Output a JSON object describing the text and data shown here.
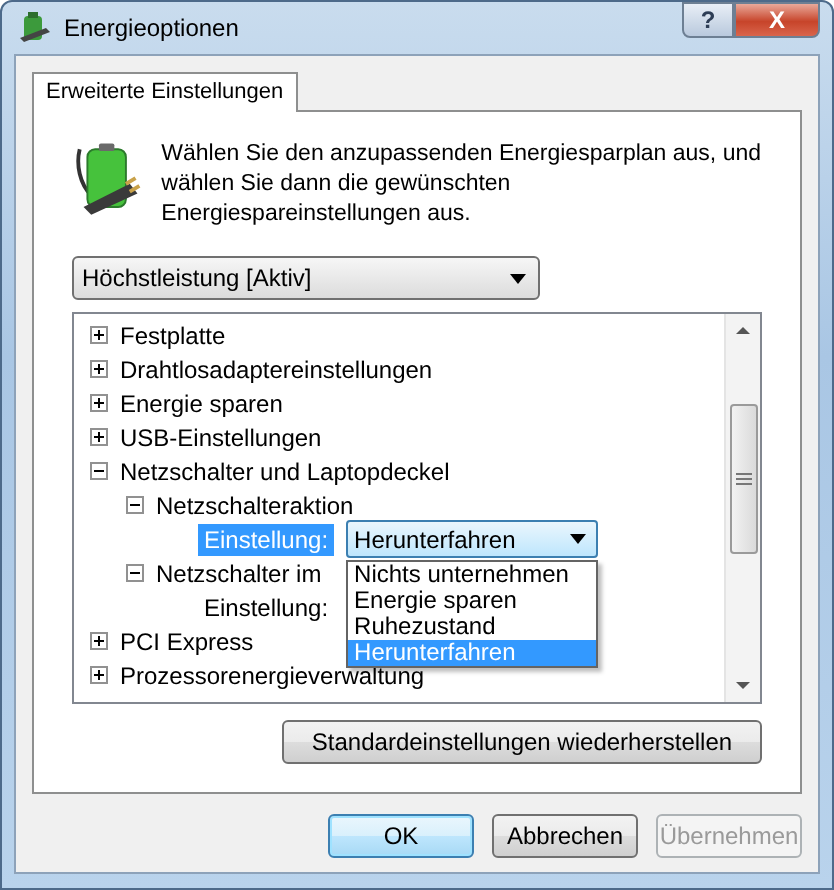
{
  "window": {
    "title": "Energieoptionen",
    "help_button": "?",
    "close_button": "X"
  },
  "tabs": [
    {
      "label": "Erweiterte Einstellungen",
      "selected": true
    }
  ],
  "intro": "Wählen Sie den anzupassenden Energiesparplan aus, und wählen Sie dann die gewünschten Energiespareinstellungen aus.",
  "plan_dropdown": {
    "value": "Höchstleistung [Aktiv]"
  },
  "tree": [
    {
      "label": "Festplatte",
      "expanded": false
    },
    {
      "label": "Drahtlosadaptereinstellungen",
      "expanded": false
    },
    {
      "label": "Energie sparen",
      "expanded": false
    },
    {
      "label": "USB-Einstellungen",
      "expanded": false
    },
    {
      "label": "Netzschalter und Laptopdeckel",
      "expanded": true,
      "children": [
        {
          "label": "Netzschalteraktion",
          "expanded": true,
          "children": [
            {
              "kind": "setting",
              "label": "Einstellung:",
              "selected": true,
              "value": "Herunterfahren",
              "open": true,
              "options": [
                {
                  "label": "Nichts unternehmen",
                  "selected": false
                },
                {
                  "label": "Energie sparen",
                  "selected": false
                },
                {
                  "label": "Ruhezustand",
                  "selected": false
                },
                {
                  "label": "Herunterfahren",
                  "selected": true
                }
              ]
            }
          ]
        },
        {
          "label": "Netzschalter im",
          "expanded": true,
          "children": [
            {
              "kind": "setting",
              "label": "Einstellung:",
              "selected": false
            }
          ]
        }
      ]
    },
    {
      "label": "PCI Express",
      "expanded": false
    },
    {
      "label": "Prozessorenergieverwaltung",
      "expanded": false
    }
  ],
  "restore_button": "Standardeinstellungen wiederherstellen",
  "buttons": [
    {
      "label": "OK",
      "disabled": false,
      "default": true
    },
    {
      "label": "Abbrechen",
      "disabled": false,
      "default": false
    },
    {
      "label": "Übernehmen",
      "disabled": true,
      "default": false
    }
  ]
}
